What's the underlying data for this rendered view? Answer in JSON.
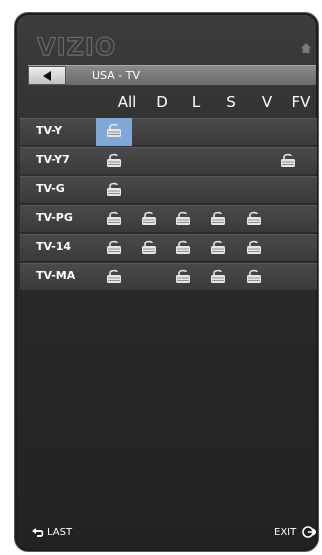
{
  "brand": "VIZIO",
  "source": {
    "label": "USA - TV"
  },
  "columns": [
    "All",
    "D",
    "L",
    "S",
    "V",
    "FV"
  ],
  "ratings": [
    {
      "label": "TV-Y",
      "locks": [
        true,
        false,
        false,
        false,
        false,
        false
      ],
      "selected_col": 0
    },
    {
      "label": "TV-Y7",
      "locks": [
        true,
        false,
        false,
        false,
        false,
        true
      ],
      "selected_col": null
    },
    {
      "label": "TV-G",
      "locks": [
        true,
        false,
        false,
        false,
        false,
        false
      ],
      "selected_col": null
    },
    {
      "label": "TV-PG",
      "locks": [
        true,
        true,
        true,
        true,
        true,
        false
      ],
      "selected_col": null
    },
    {
      "label": "TV-14",
      "locks": [
        true,
        true,
        true,
        true,
        true,
        false
      ],
      "selected_col": null
    },
    {
      "label": "TV-MA",
      "locks": [
        true,
        false,
        true,
        true,
        true,
        false
      ],
      "selected_col": null
    }
  ],
  "footer": {
    "last_label": "LAST",
    "exit_label": "EXIT"
  },
  "icons": {
    "home": "home-icon",
    "back": "left-arrow-icon",
    "lock": "lock-icon",
    "last": "return-arrow-icon",
    "exit": "exit-arrow-icon"
  },
  "colors": {
    "selected_cell": "#7ea7d8",
    "lock_icon": "#e6e6e6"
  }
}
